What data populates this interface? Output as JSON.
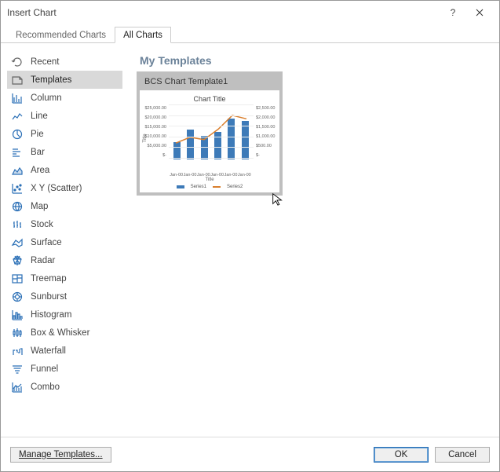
{
  "window": {
    "title": "Insert Chart",
    "help_icon": "?",
    "close_icon": "×"
  },
  "tabs": [
    {
      "label": "Recommended Charts",
      "active": false
    },
    {
      "label": "All Charts",
      "active": true
    }
  ],
  "sidebar": {
    "items": [
      {
        "label": "Recent",
        "icon": "recent"
      },
      {
        "label": "Templates",
        "icon": "templates",
        "selected": true
      },
      {
        "label": "Column",
        "icon": "column"
      },
      {
        "label": "Line",
        "icon": "line"
      },
      {
        "label": "Pie",
        "icon": "pie"
      },
      {
        "label": "Bar",
        "icon": "bar"
      },
      {
        "label": "Area",
        "icon": "area"
      },
      {
        "label": "X Y (Scatter)",
        "icon": "scatter"
      },
      {
        "label": "Map",
        "icon": "map"
      },
      {
        "label": "Stock",
        "icon": "stock"
      },
      {
        "label": "Surface",
        "icon": "surface"
      },
      {
        "label": "Radar",
        "icon": "radar"
      },
      {
        "label": "Treemap",
        "icon": "treemap"
      },
      {
        "label": "Sunburst",
        "icon": "sunburst"
      },
      {
        "label": "Histogram",
        "icon": "histogram"
      },
      {
        "label": "Box & Whisker",
        "icon": "box"
      },
      {
        "label": "Waterfall",
        "icon": "waterfall"
      },
      {
        "label": "Funnel",
        "icon": "funnel"
      },
      {
        "label": "Combo",
        "icon": "combo"
      }
    ]
  },
  "main": {
    "section_title": "My Templates",
    "template": {
      "name": "BCS Chart Template1"
    }
  },
  "footer": {
    "manage": "Manage Templates...",
    "ok": "OK",
    "cancel": "Cancel"
  },
  "chart_data": {
    "type": "bar+line",
    "title": "Chart Title",
    "xlabel": "Title",
    "ylabel_left": "Title",
    "ylabel_right": "",
    "categories": [
      "Jan-00",
      "Jan-00",
      "Jan-00",
      "Jan-00",
      "Jan-00",
      "Jan-00"
    ],
    "y_left_ticks": [
      "$25,000.00",
      "$20,000.00",
      "$15,000.00",
      "$10,000.00",
      "$5,000.00",
      "$-"
    ],
    "y_right_ticks": [
      "$2,500.00",
      "$2,000.00",
      "$1,500.00",
      "$1,000.00",
      "$500.00",
      "$-"
    ],
    "ylim_left": [
      0,
      25000
    ],
    "ylim_right": [
      0,
      2500
    ],
    "series": [
      {
        "name": "Series1",
        "type": "bar",
        "axis": "left",
        "values": [
          8000,
          14000,
          11000,
          13000,
          19000,
          18000
        ]
      },
      {
        "name": "Series2",
        "type": "line",
        "axis": "right",
        "values": [
          900,
          1150,
          1050,
          1500,
          2100,
          1950
        ]
      }
    ]
  }
}
